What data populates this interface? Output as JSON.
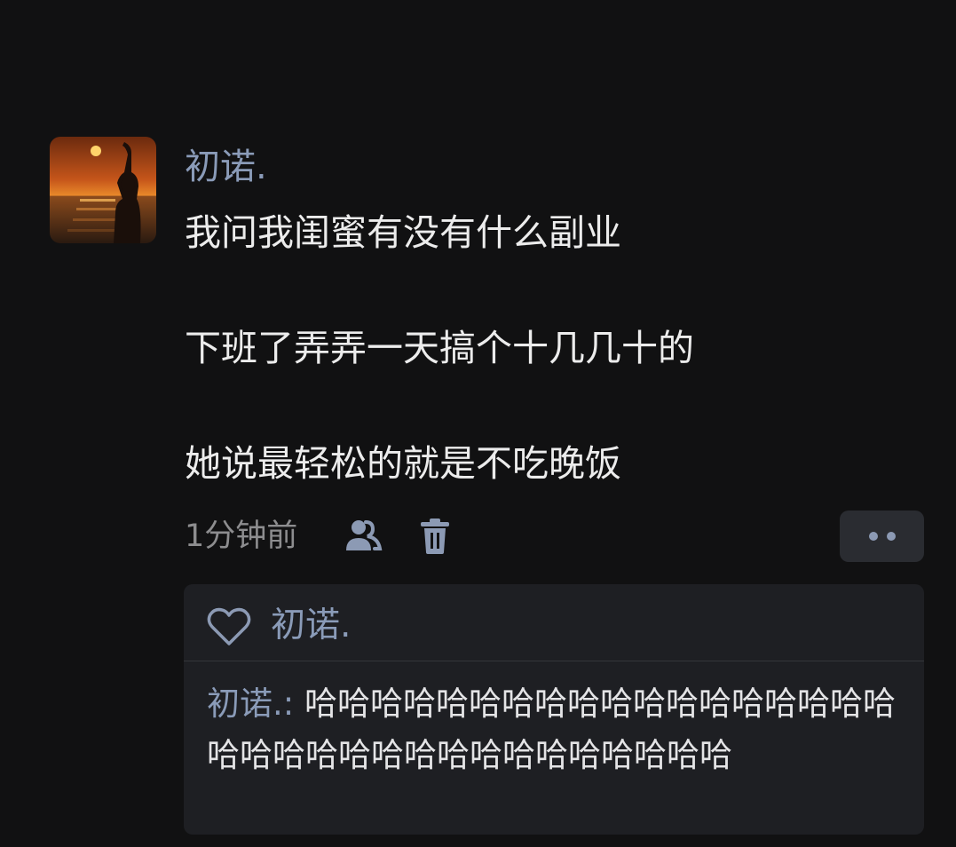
{
  "post": {
    "username": "初诺.",
    "lines": [
      "我问我闺蜜有没有什么副业",
      "下班了弄弄一天搞个十几几十的",
      "她说最轻松的就是不吃晚饭"
    ],
    "time": "1分钟前"
  },
  "likes": {
    "names": "初诺."
  },
  "comment": {
    "author": "初诺.",
    "separator": ": ",
    "text": "哈哈哈哈哈哈哈哈哈哈哈哈哈哈哈哈哈哈哈哈哈哈哈哈哈哈哈哈哈哈哈哈哈哈"
  },
  "colors": {
    "background": "#111112",
    "name_accent": "#8a9bb8",
    "panel": "#1e1f23"
  },
  "icons": {
    "visibility": "user-group-icon",
    "delete": "trash-icon",
    "more": "more-dots-icon",
    "like": "heart-outline-icon"
  }
}
